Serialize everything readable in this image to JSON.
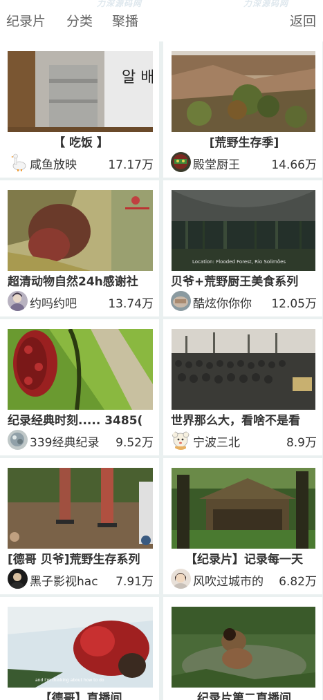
{
  "header": {
    "nav_documentary": "纪录片",
    "nav_category": "分类",
    "nav_live": "聚播",
    "nav_back": "返回",
    "watermark_1": "力深源码网",
    "watermark_2": "力深源码网"
  },
  "cards": [
    {
      "title": "【 吃饭 】",
      "author": "咸鱼放映",
      "views": "17.17万"
    },
    {
      "title": "[荒野生存季]",
      "author": "殿堂厨王",
      "views": "14.66万"
    },
    {
      "title": "超清动物自然24h感谢社",
      "author": "约吗约吧",
      "views": "13.74万"
    },
    {
      "title": "贝爷+荒野厨王美食系列",
      "author": "酷炫你你你",
      "views": "12.05万"
    },
    {
      "title": "纪录经典时刻..... 3485(",
      "author": "339经典纪录",
      "views": "9.52万"
    },
    {
      "title": "世界那么大，看啥不是看",
      "author": "宁波三北",
      "views": "8.9万"
    },
    {
      "title": "[德哥 贝爷]荒野生存系列",
      "author": "黑子影视hac",
      "views": "7.91万"
    },
    {
      "title": "【纪录片】记录每一天",
      "author": "风吹过城市的",
      "views": "6.82万"
    },
    {
      "title": "【德哥】直播间",
      "author": "",
      "views": ""
    },
    {
      "title": "纪录片第二直播间",
      "author": "",
      "views": ""
    }
  ],
  "overlay_texts": {
    "card4_caption": "Location: Flooded Forest, Rio Solimões",
    "card9_caption": "and I'm thinking about how to do"
  },
  "colors": {
    "accent": "#666666",
    "background": "#eaf0f0"
  }
}
